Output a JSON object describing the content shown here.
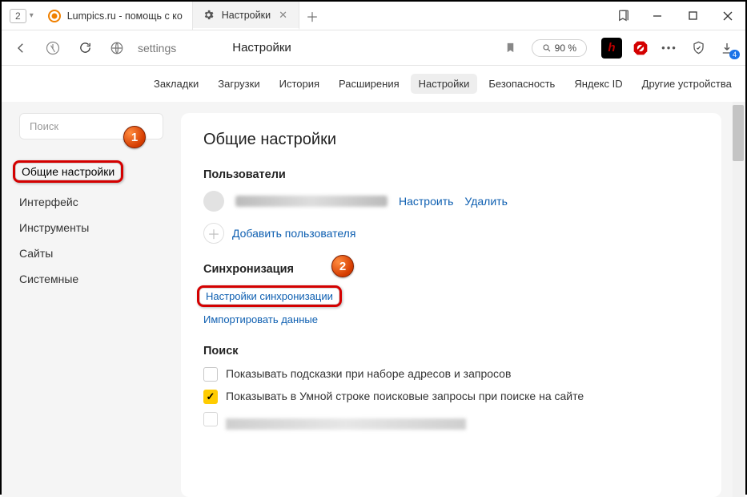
{
  "window": {
    "tab_count": "2",
    "tabs": [
      {
        "title": "Lumpics.ru - помощь с ко"
      },
      {
        "title": "Настройки"
      }
    ]
  },
  "addr": {
    "url_text": "settings",
    "page_title": "Настройки",
    "zoom": "90 %",
    "download_badge": "4"
  },
  "page_nav": [
    "Закладки",
    "Загрузки",
    "История",
    "Расширения",
    "Настройки",
    "Безопасность",
    "Яндекс ID",
    "Другие устройства"
  ],
  "page_nav_active_index": 4,
  "sidebar": {
    "search_placeholder": "Поиск",
    "items": [
      "Общие настройки",
      "Интерфейс",
      "Инструменты",
      "Сайты",
      "Системные"
    ],
    "active_index": 0
  },
  "main": {
    "heading": "Общие настройки",
    "users_title": "Пользователи",
    "user_configure": "Настроить",
    "user_delete": "Удалить",
    "add_user": "Добавить пользователя",
    "sync_title": "Синхронизация",
    "sync_settings": "Настройки синхронизации",
    "import_data": "Импортировать данные",
    "search_title": "Поиск",
    "cb1": "Показывать подсказки при наборе адресов и запросов",
    "cb2": "Показывать в Умной строке поисковые запросы при поиске на сайте"
  },
  "annotations": {
    "a1": "1",
    "a2": "2"
  }
}
